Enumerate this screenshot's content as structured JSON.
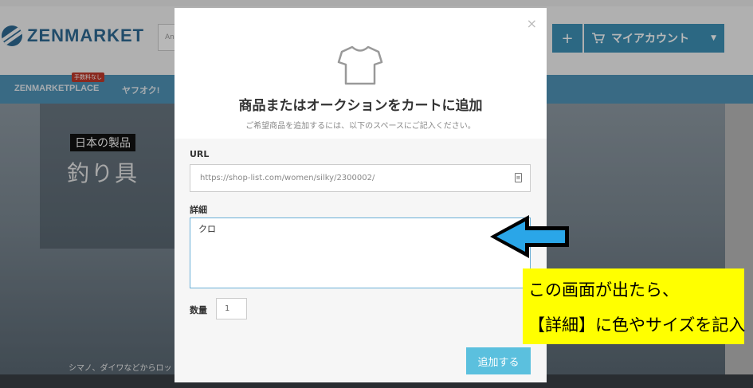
{
  "site": {
    "logo_text": "ZENMARKET",
    "search_placeholder_fragment": "An",
    "plus_label": "+",
    "account_label": "マイアカウント",
    "nav": [
      "ZENMARKETPLACE",
      "ヤフオク!"
    ],
    "nav_badge": "手数料なし",
    "hero_tag": "日本の製品",
    "hero_title": "釣り具",
    "hero_sub": "シマノ、ダイワなどからロッ"
  },
  "modal": {
    "close": "×",
    "title": "商品またはオークションをカートに追加",
    "subtitle": "ご希望商品を追加するには、以下のスペースにご記入ください。",
    "url_label": "URL",
    "url_value": "https://shop-list.com/women/silky/2300002/",
    "detail_label": "詳細",
    "detail_value": "クロ",
    "qty_label": "数量",
    "qty_value": "1",
    "submit_label": "追加する"
  },
  "annotation": {
    "line1": "この画面が出たら、",
    "line2": "【詳細】に色やサイズを記入",
    "arrow_color": "#2aa6e8",
    "callout_color": "#ffff00"
  }
}
